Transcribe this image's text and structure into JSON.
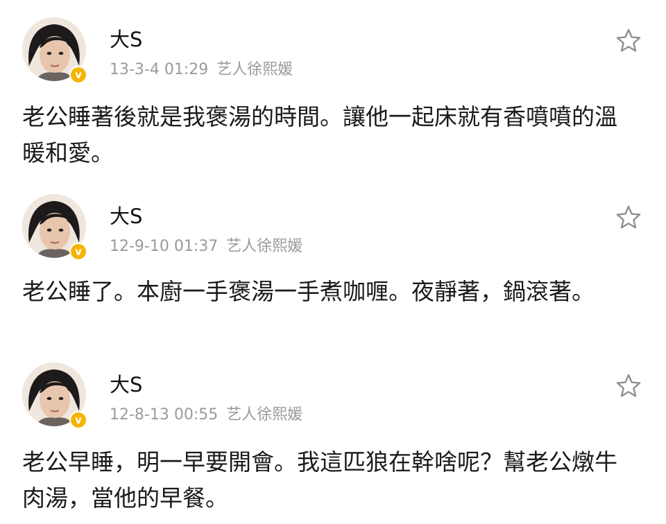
{
  "posts": [
    {
      "username": "大S",
      "verified_badge": "v",
      "timestamp": "13-3-4 01:29",
      "source": "艺人徐熙媛",
      "text": "老公睡著後就是我褒湯的時間。讓他一起床就有香噴噴的溫暖和愛。",
      "favorite_icon": "star-outline-icon"
    },
    {
      "username": "大S",
      "verified_badge": "v",
      "timestamp": "12-9-10 01:37",
      "source": "艺人徐熙媛",
      "text": "老公睡了。本廚一手褒湯一手煮咖喱。夜靜著，鍋滾著。",
      "favorite_icon": "star-outline-icon"
    },
    {
      "username": "大S",
      "verified_badge": "v",
      "timestamp": "12-8-13 00:55",
      "source": "艺人徐熙媛",
      "text": "老公早睡，明一早要開會。我這匹狼在幹啥呢？幫老公燉牛肉湯，當他的早餐。",
      "favorite_icon": "star-outline-icon"
    }
  ],
  "colors": {
    "badge": "#f5b400",
    "meta_text": "#9a9a9a",
    "body_text": "#1a1a1a",
    "star_outline": "#9a9a9a"
  }
}
